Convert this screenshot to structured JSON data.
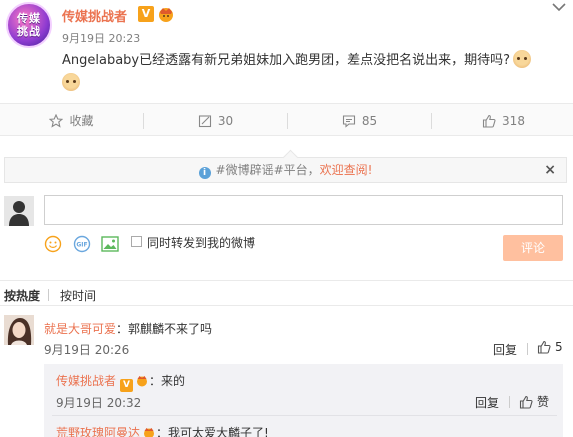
{
  "post": {
    "author": "传媒挑战者",
    "avatar_text": "传媒挑战",
    "time": "9月19日 20:23",
    "text": "Angelababy已经透露有新兄弟姐妹加入跑男团，差点没把名说出来，期待吗?",
    "icons": {
      "verified": "V",
      "crown": "crown-badge-icon",
      "emoji": "cat-face-emoji",
      "menu": "chevron-down-icon"
    }
  },
  "actions": {
    "favorite_label": "收藏",
    "repost_count": "30",
    "comment_count": "85",
    "like_count": "318"
  },
  "notice": {
    "prefix": "#微博辟谣#平台，",
    "link": "欢迎查阅!",
    "close": "×"
  },
  "composer": {
    "input_value": "",
    "repost_label": "同时转发到我的微博",
    "submit_label": "评论"
  },
  "sort": {
    "hot": "按热度",
    "time": "按时间"
  },
  "comments": [
    {
      "author": "就是大哥可爱",
      "colon": "：",
      "text": "郭麒麟不来了吗",
      "time": "9月19日 20:26",
      "reply_label": "回复",
      "like_count": "5",
      "replies": [
        {
          "author": "传媒挑战者",
          "colon": "：",
          "text": "来的",
          "time": "9月19日 20:32",
          "reply_label": "回复",
          "like_label": "赞"
        },
        {
          "author": "荒野玫瑰阿曼达",
          "colon": "：",
          "text": "我可太爱大麟子了!"
        }
      ]
    }
  ],
  "colors": {
    "accent": "#eb7350",
    "verified": "#f7a21b",
    "submit_disabled": "#ffc09f",
    "link_blue": "#5ba1d8"
  }
}
